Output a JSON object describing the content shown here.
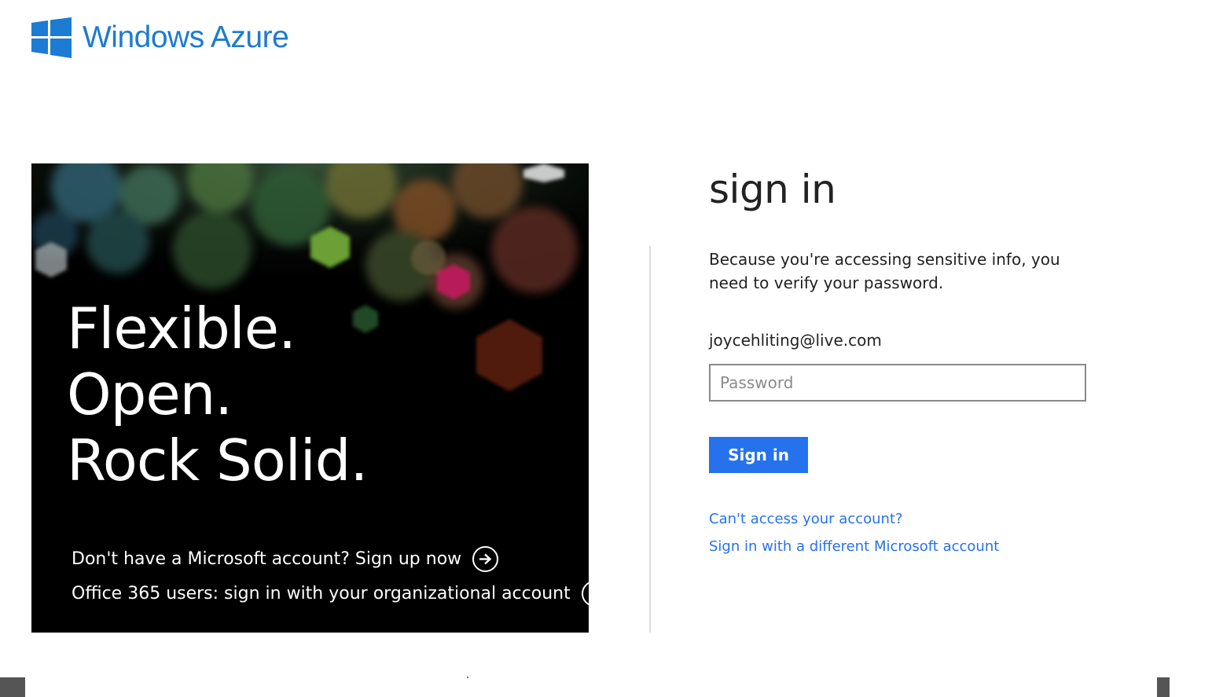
{
  "header": {
    "logo_text": "Windows Azure",
    "logo_icon": "windows-logo-icon",
    "brand_color": "#1c7bd2"
  },
  "hero": {
    "headline": [
      "Flexible.",
      "Open.",
      "Rock Solid."
    ],
    "signup_link": "Don't have a Microsoft account? Sign up now",
    "office_link": "Office 365 users: sign in with your organizational account",
    "arrow_icon": "arrow-right-circle-icon"
  },
  "signin": {
    "title": "sign in",
    "description": "Because you're accessing sensitive info, you need to verify your password.",
    "email": "joycehliting@live.com",
    "password_placeholder": "Password",
    "password_value": "",
    "button_label": "Sign in",
    "button_color": "#2672ec",
    "cant_access_link": "Can't access your account?",
    "different_account_link": "Sign in with a different Microsoft account"
  }
}
